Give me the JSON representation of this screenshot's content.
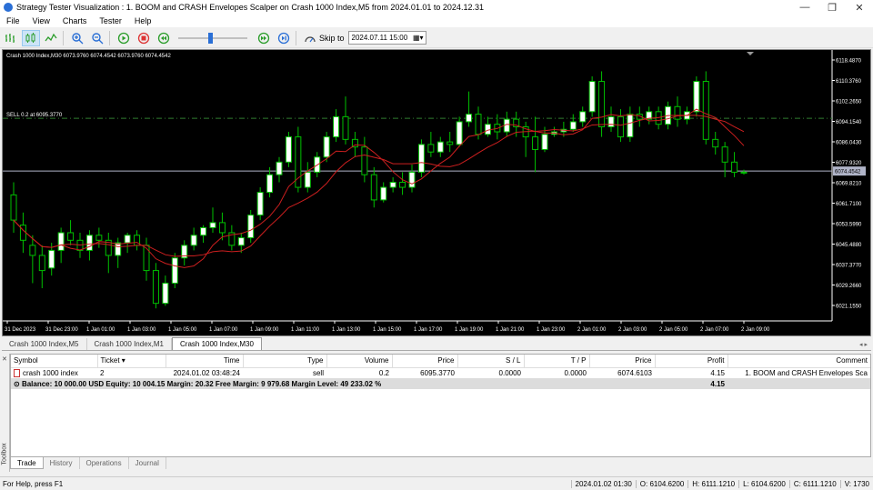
{
  "window": {
    "title": "Strategy Tester Visualization : 1. BOOM and CRASH Envelopes Scalper on Crash 1000 Index,M5 from 2024.01.01 to 2024.12.31",
    "minimize": "—",
    "restore": "❐",
    "close": "✕"
  },
  "menu": [
    "File",
    "View",
    "Charts",
    "Tester",
    "Help"
  ],
  "toolbar": {
    "skip_label": "Skip to",
    "skip_date": "2024.07.11 15:00",
    "speed_fraction": 0.47
  },
  "chart": {
    "info": "Crash 1000 Index,M30  6073.9760 6074.4542 6073.9760 6074.4542",
    "order_label": "SELL 0.2 at 6095.3770",
    "current_price": "6074.4542",
    "price_ticks": [
      "6118.4870",
      "6110.3760",
      "6102.2650",
      "6094.1540",
      "6086.0430",
      "6077.9320",
      "6069.8210",
      "6061.7100",
      "6053.5990",
      "6045.4880",
      "6037.3770",
      "6029.2660",
      "6021.1550"
    ],
    "time_ticks": [
      "31 Dec 2023",
      "31 Dec 23:00",
      "1 Jan 01:00",
      "1 Jan 03:00",
      "1 Jan 05:00",
      "1 Jan 07:00",
      "1 Jan 09:00",
      "1 Jan 11:00",
      "1 Jan 13:00",
      "1 Jan 15:00",
      "1 Jan 17:00",
      "1 Jan 19:00",
      "1 Jan 21:00",
      "1 Jan 23:00",
      "2 Jan 01:00",
      "2 Jan 03:00",
      "2 Jan 05:00",
      "2 Jan 07:00",
      "2 Jan 09:00"
    ],
    "colors": {
      "bg": "#000000",
      "bull": "#ffffff",
      "bear": "#000000",
      "wick": "#00c000",
      "ma": "#cc1f1f",
      "order_line": "#2f7d2f",
      "price_line": "#b0b4c8"
    }
  },
  "chart_tabs": [
    "Crash 1000 Index,M5",
    "Crash 1000 Index,M1",
    "Crash 1000 Index,M30"
  ],
  "chart_tabs_active": 2,
  "trade_table": {
    "headers": [
      "Symbol",
      "Ticket",
      "Time",
      "Type",
      "Volume",
      "Price",
      "S / L",
      "T / P",
      "Price",
      "Profit",
      "Comment"
    ],
    "row": [
      "crash 1000 index",
      "2",
      "2024.01.02 03:48:24",
      "sell",
      "0.2",
      "6095.3770",
      "0.0000",
      "0.0000",
      "6074.6103",
      "4.15",
      "1. BOOM and CRASH Envelopes Sca"
    ],
    "balance": "Balance: 10 000.00 USD  Equity: 10 004.15  Margin: 20.32  Free Margin: 9 979.68  Margin Level: 49 233.02 %",
    "balance_profit": "4.15"
  },
  "bottom_tabs": [
    "Trade",
    "History",
    "Operations",
    "Journal"
  ],
  "toolbox_label": "Toolbox",
  "status": {
    "help": "For Help, press F1",
    "datetime": "2024.01.02 01:30",
    "open": "O: 6104.6200",
    "high": "H: 6111.1210",
    "low": "L: 6104.6200",
    "close": "C: 6111.1210",
    "volume": "V: 1730"
  }
}
